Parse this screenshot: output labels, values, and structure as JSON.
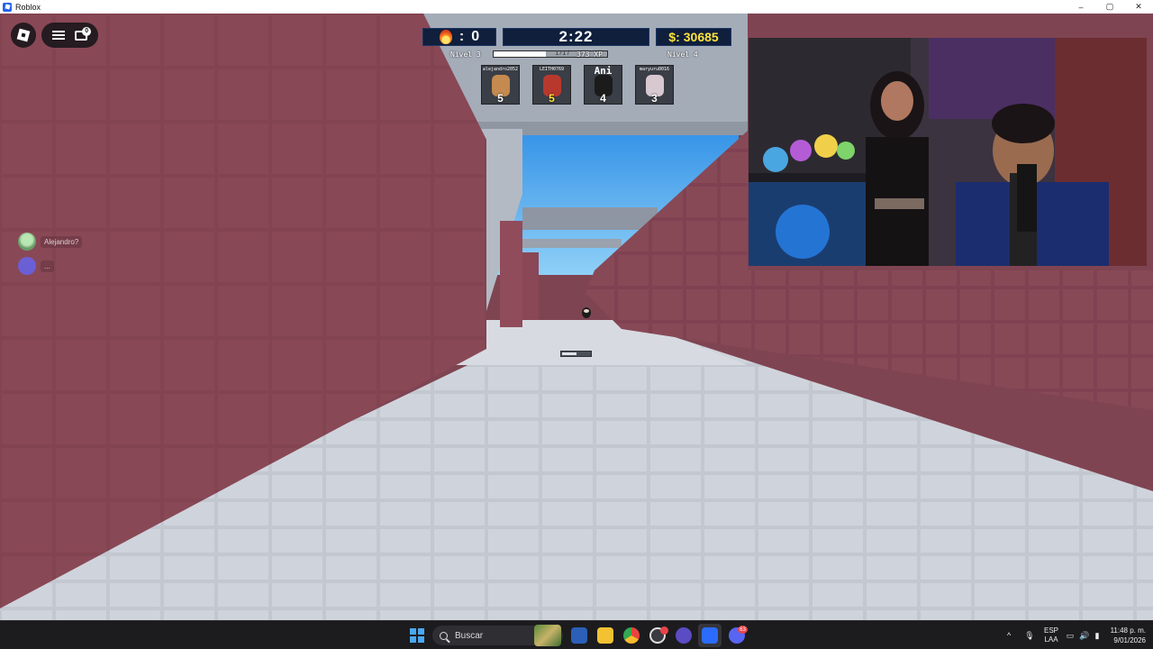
{
  "window": {
    "title": "Roblox",
    "controls": {
      "minimize": "–",
      "maximize": "▢",
      "close": "✕"
    }
  },
  "roblox_ui": {
    "chat_badge": "0"
  },
  "hud": {
    "kills": "0",
    "timer": "2:22",
    "money_label": "$:",
    "money": "30685",
    "level_current": "Nivel 3",
    "level_next": "Nivel 4",
    "xp_current": "171",
    "xp_separator": "/",
    "xp_total": "373 XP",
    "xp_progress_percent": 46,
    "players": [
      {
        "name": "alejandro2052",
        "kills": "5",
        "avatar_color": "#c48a4f",
        "highlight": false
      },
      {
        "name": "LEITH0769",
        "kills": "5",
        "avatar_color": "#b8382e",
        "highlight": true
      },
      {
        "name": "Ani",
        "kills": "4",
        "avatar_color": "#1b1b1b",
        "highlight": false
      },
      {
        "name": "maryuru0016",
        "kills": "3",
        "avatar_color": "#d8c8d0",
        "highlight": false
      }
    ]
  },
  "side_chat": [
    {
      "label": "Alejandro?",
      "icon": "avatar-icon"
    },
    {
      "label": "...",
      "icon": "discord-icon"
    }
  ],
  "taskbar": {
    "search_placeholder": "Buscar",
    "lang_top": "ESP",
    "lang_bottom": "LAA",
    "time": "11:48 p. m.",
    "date": "9/01/2026",
    "discord_badge": "63"
  },
  "colors": {
    "wall": "#8a4a58",
    "floor": "#c9ced6",
    "sky": "#4aa2e8",
    "hud_bg": "#0f1f3c",
    "money": "#ffe33b"
  }
}
